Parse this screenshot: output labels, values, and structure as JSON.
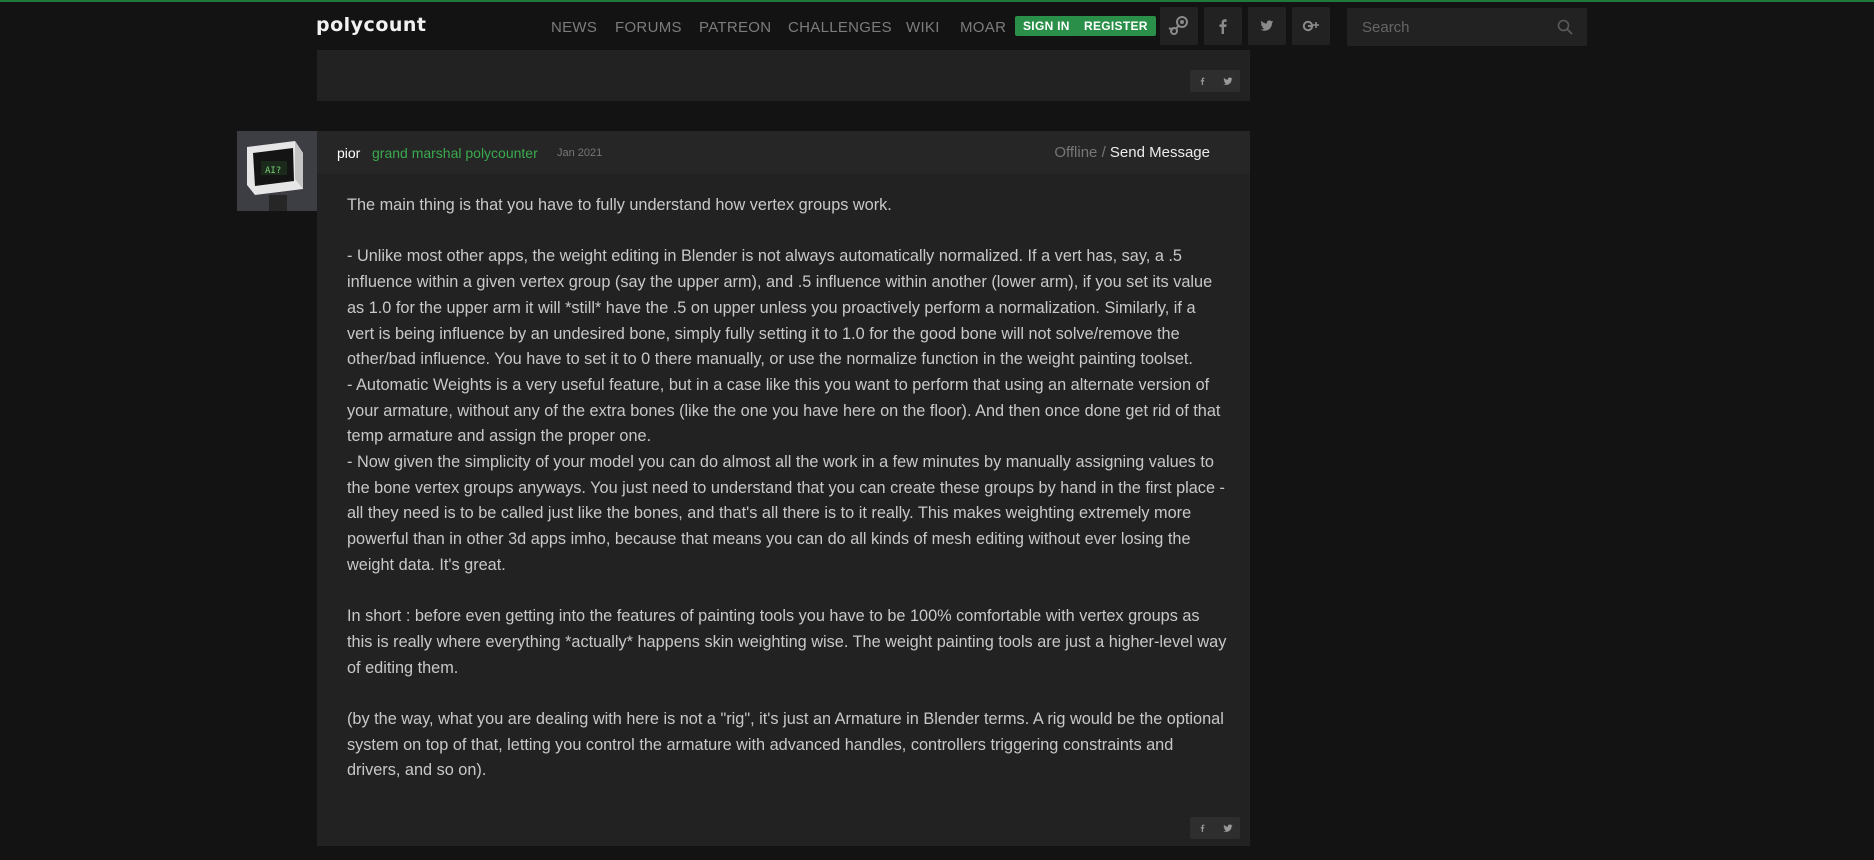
{
  "nav": {
    "logo": "polycount",
    "links": [
      "NEWS",
      "FORUMS",
      "PATREON",
      "CHALLENGES",
      "WIKI",
      "MOAR"
    ],
    "sign_in": "SIGN IN",
    "register": "REGISTER",
    "search_placeholder": "Search"
  },
  "post": {
    "author": "pior",
    "rank": "grand marshal polycounter",
    "date": "Jan 2021",
    "status": "Offline",
    "status_sep": " / ",
    "send_message": "Send Message",
    "paragraphs": [
      "The main thing is that you have to fully understand how vertex groups work.",
      "- Unlike most other apps, the weight editing in Blender is not always automatically normalized. If a vert has, say, a .5 influence within a given vertex group (say the upper arm), and .5 influence within another (lower arm), if you set its value as 1.0 for the upper arm it will *still* have the .5 on upper unless you proactively perform a normalization. Similarly, if a vert is being influence by an undesired bone, simply fully setting it to 1.0 for the good bone will not solve/remove the other/bad influence. You have to set it to 0 there manually, or use the normalize function in the weight painting toolset.\n- Automatic Weights is a very useful feature, but in a case like this you want to perform that using an alternate version of your armature, without any of the extra bones (like the one you have here on the floor). And then once done get rid of that temp armature and assign the proper one.\n- Now given the simplicity of your model you can do almost all the work in a few minutes by manually assigning values to the bone vertex groups anyways. You just need to understand that you can create these groups by hand in the first place - all they need is to be called just like the bones, and that's all there is to it really. This makes weighting extremely more powerful than in other 3d apps imho, because that means you can do all kinds of mesh editing without ever losing the weight data. It's great.",
      "In short : before even getting into the features of painting tools you have to be 100% comfortable with vertex groups as this is really where everything *actually* happens skin weighting wise. The weight painting tools are just a higher-level way of editing them.",
      "(by the way, what you are dealing with here is not a \"rig\", it's just an Armature in Blender terms. A rig would be the optional system on top of that, letting you control the armature with advanced handles, controllers triggering constraints and drivers, and so on)."
    ]
  },
  "share": {
    "facebook_glyph": "f",
    "twitter_glyph": "•"
  },
  "colors": {
    "background": "#131313",
    "panel": "#222222",
    "accent_green": "#2a8f48",
    "rank_green": "#3aaa4e"
  }
}
